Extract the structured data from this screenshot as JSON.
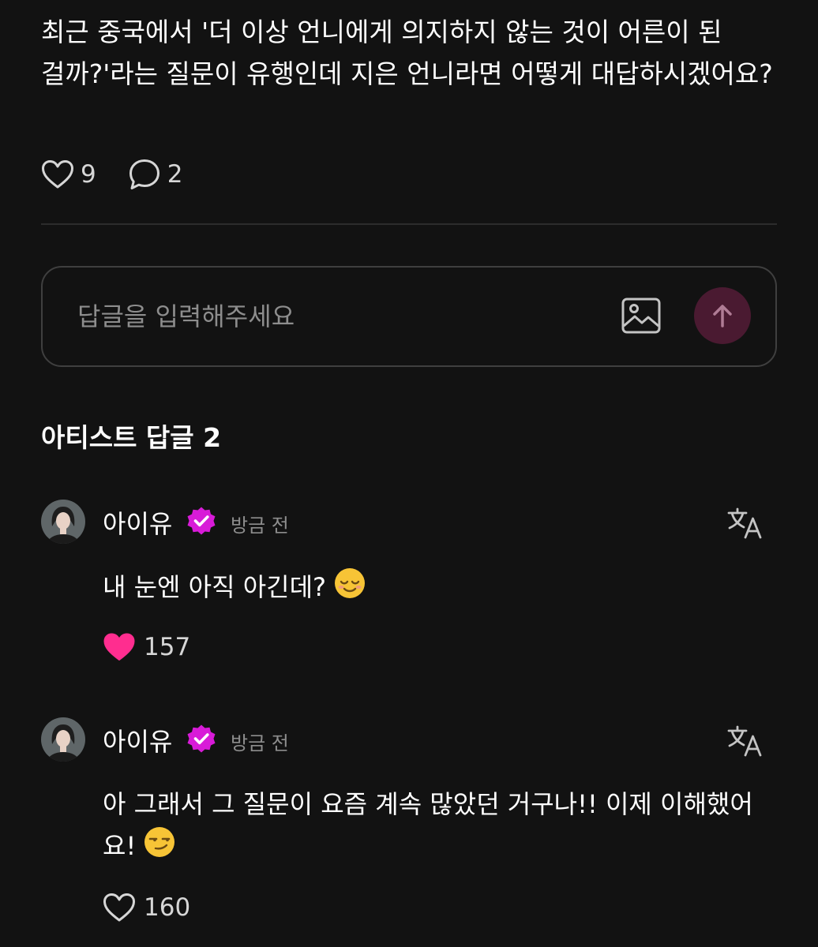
{
  "post": {
    "text": "최근 중국에서 '더 이상 언니에게 의지하지 않는 것이 어른이 된 걸까?'라는 질문이 유행인데 지은 언니라면 어떻게 대답하시겠어요?",
    "likes": "9",
    "comments": "2"
  },
  "reply_box": {
    "placeholder": "답글을 입력해주세요",
    "image_icon": "image-icon",
    "send_icon": "arrow-up-icon"
  },
  "artist_replies": {
    "title": "아티스트 답글 2",
    "items": [
      {
        "name": "아이유",
        "time": "방금 전",
        "text": "내 눈엔 아직 아긴데?",
        "emoji": "relieved-face-emoji",
        "likes": "157",
        "liked": true
      },
      {
        "name": "아이유",
        "time": "방금 전",
        "text": "아 그래서 그 질문이 요즘 계속 많았던 거구나!! 이제 이해했어요!",
        "emoji": "smirking-face-emoji",
        "likes": "160",
        "liked": false
      }
    ]
  },
  "colors": {
    "background": "#121212",
    "liked_heart": "#ff2d8f",
    "verified_badge": "#d81bd8",
    "send_button": "#4a1a31",
    "muted_text": "#8d8d8d"
  }
}
